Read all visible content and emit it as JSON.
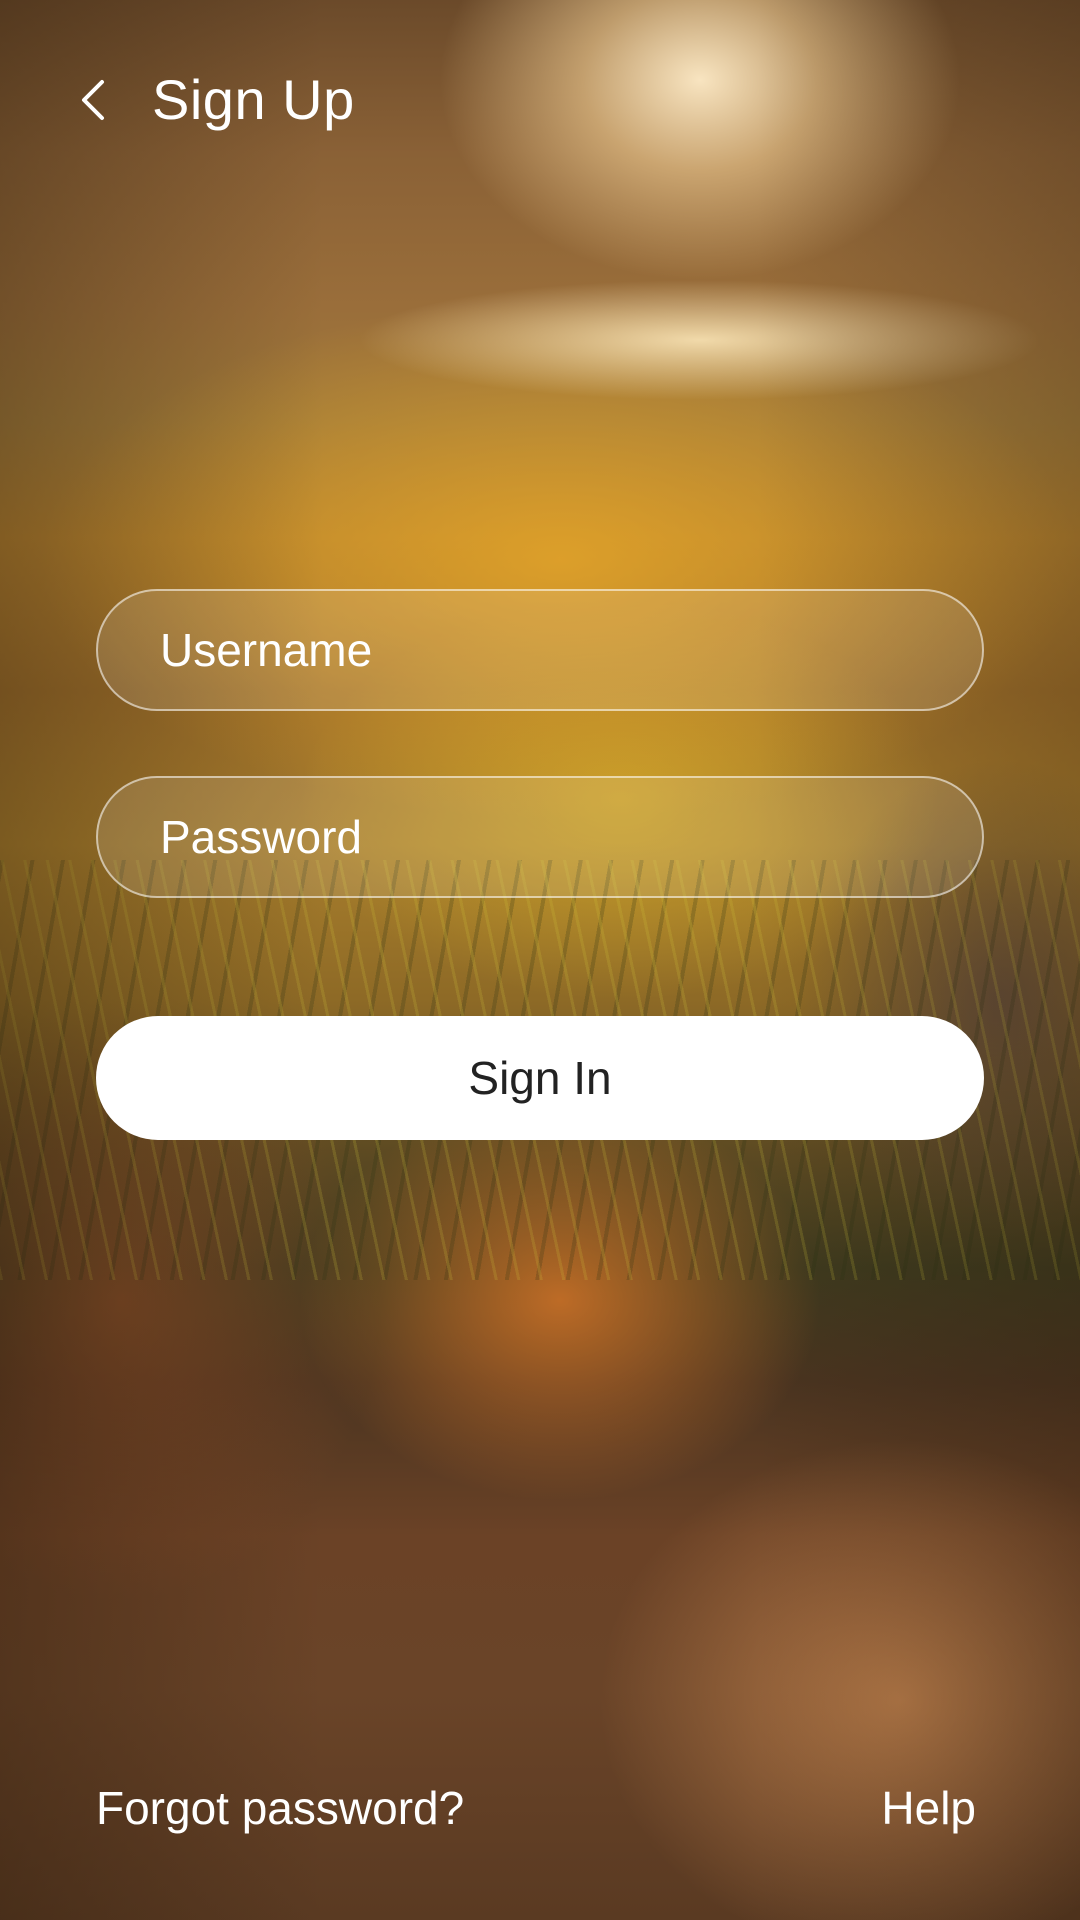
{
  "header": {
    "back_icon": "chevron-left-icon",
    "title": "Sign Up"
  },
  "form": {
    "username_placeholder": "Username",
    "password_placeholder": "Password",
    "sign_in_label": "Sign In"
  },
  "footer": {
    "forgot_password_label": "Forgot password?",
    "help_label": "Help"
  },
  "colors": {
    "text": "#ffffff",
    "button_background": "#ffffff",
    "button_text": "#222222"
  }
}
